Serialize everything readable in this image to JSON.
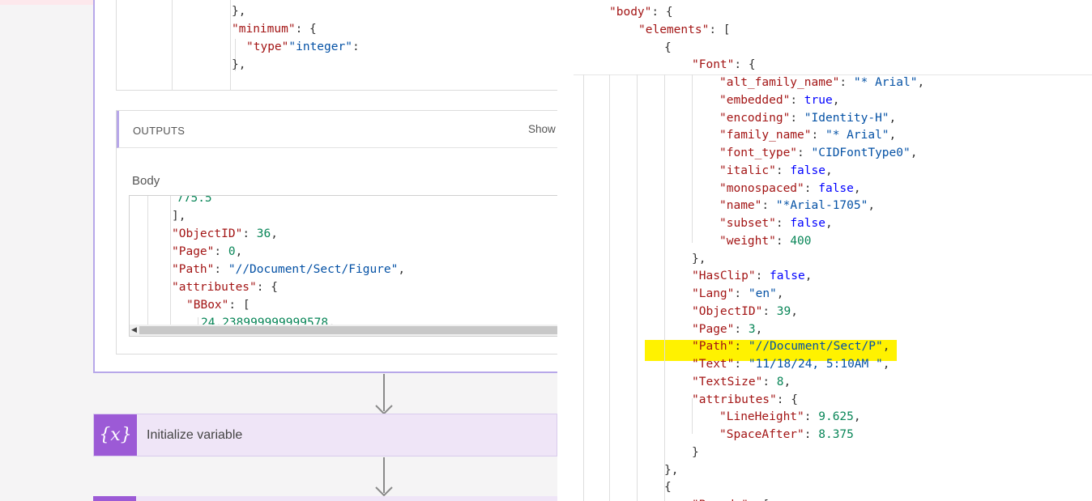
{
  "left": {
    "top_code": [
      {
        "k": "",
        "rest": "},"
      },
      {
        "k": "\"minimum\"",
        "rest": ": {"
      },
      {
        "k": "\"type\"",
        "rest": ": ",
        "s": "\"integer\""
      },
      {
        "k": "",
        "rest": "},"
      }
    ],
    "outputs": {
      "label": "OUTPUTS",
      "show_link": "Show r",
      "body_label": "Body",
      "code": [
        {
          "n": "775.5"
        },
        {
          "p": "],"
        },
        {
          "k": "\"ObjectID\"",
          "p": ": ",
          "n": "36",
          "p2": ","
        },
        {
          "k": "\"Page\"",
          "p": ": ",
          "n": "0",
          "p2": ","
        },
        {
          "k": "\"Path\"",
          "p": ": ",
          "s": "\"//Document/Sect/Figure\"",
          "p2": ","
        },
        {
          "k": "\"attributes\"",
          "p": ": {"
        },
        {
          "k": "\"BBox\"",
          "p": ": ["
        },
        {
          "n": "24.238999999999578",
          "p2": ","
        }
      ]
    },
    "variable_card": {
      "icon": "{x}",
      "label": "Initialize variable"
    }
  },
  "right": {
    "lines": [
      {
        "indent": 64,
        "k": "\"body\"",
        "p": ": {"
      },
      {
        "indent": 100,
        "k": "\"elements\"",
        "p": ": ["
      },
      {
        "indent": 132,
        "p": "{"
      },
      {
        "indent": 166,
        "k": "\"Font\"",
        "p": ": {"
      },
      {
        "indent": 200,
        "k": "\"alt_family_name\"",
        "p": ": ",
        "s": "\"* Arial\"",
        "p2": ","
      },
      {
        "indent": 200,
        "k": "\"embedded\"",
        "p": ": ",
        "b": "true",
        "p2": ","
      },
      {
        "indent": 200,
        "k": "\"encoding\"",
        "p": ": ",
        "s": "\"Identity-H\"",
        "p2": ","
      },
      {
        "indent": 200,
        "k": "\"family_name\"",
        "p": ": ",
        "s": "\"* Arial\"",
        "p2": ","
      },
      {
        "indent": 200,
        "k": "\"font_type\"",
        "p": ": ",
        "s": "\"CIDFontType0\"",
        "p2": ","
      },
      {
        "indent": 200,
        "k": "\"italic\"",
        "p": ": ",
        "b": "false",
        "p2": ","
      },
      {
        "indent": 200,
        "k": "\"monospaced\"",
        "p": ": ",
        "b": "false",
        "p2": ","
      },
      {
        "indent": 200,
        "k": "\"name\"",
        "p": ": ",
        "s": "\"*Arial-1705\"",
        "p2": ","
      },
      {
        "indent": 200,
        "k": "\"subset\"",
        "p": ": ",
        "b": "false",
        "p2": ","
      },
      {
        "indent": 200,
        "k": "\"weight\"",
        "p": ": ",
        "n": "400"
      },
      {
        "indent": 166,
        "p": "},"
      },
      {
        "indent": 166,
        "k": "\"HasClip\"",
        "p": ": ",
        "b": "false",
        "p2": ","
      },
      {
        "indent": 166,
        "k": "\"Lang\"",
        "p": ": ",
        "s": "\"en\"",
        "p2": ","
      },
      {
        "indent": 166,
        "k": "\"ObjectID\"",
        "p": ": ",
        "n": "39",
        "p2": ","
      },
      {
        "indent": 166,
        "k": "\"Page\"",
        "p": ": ",
        "n": "3",
        "p2": ","
      },
      {
        "indent": 166,
        "k": "\"Path\"",
        "p": ": ",
        "s": "\"//Document/Sect/P\"",
        "p2": ","
      },
      {
        "indent": 166,
        "k": "\"Text\"",
        "p": ": ",
        "s": "\"11/18/24, 5:10AM \"",
        "p2": ","
      },
      {
        "indent": 166,
        "k": "\"TextSize\"",
        "p": ": ",
        "n": "8",
        "p2": ","
      },
      {
        "indent": 166,
        "k": "\"attributes\"",
        "p": ": {"
      },
      {
        "indent": 200,
        "k": "\"LineHeight\"",
        "p": ": ",
        "n": "9.625",
        "p2": ","
      },
      {
        "indent": 200,
        "k": "\"SpaceAfter\"",
        "p": ": ",
        "n": "8.375"
      },
      {
        "indent": 166,
        "p": "}"
      },
      {
        "indent": 132,
        "p": "},"
      },
      {
        "indent": 132,
        "p": "{"
      },
      {
        "indent": 166,
        "k": "\"Bounds\"",
        "p": ": ["
      }
    ]
  }
}
